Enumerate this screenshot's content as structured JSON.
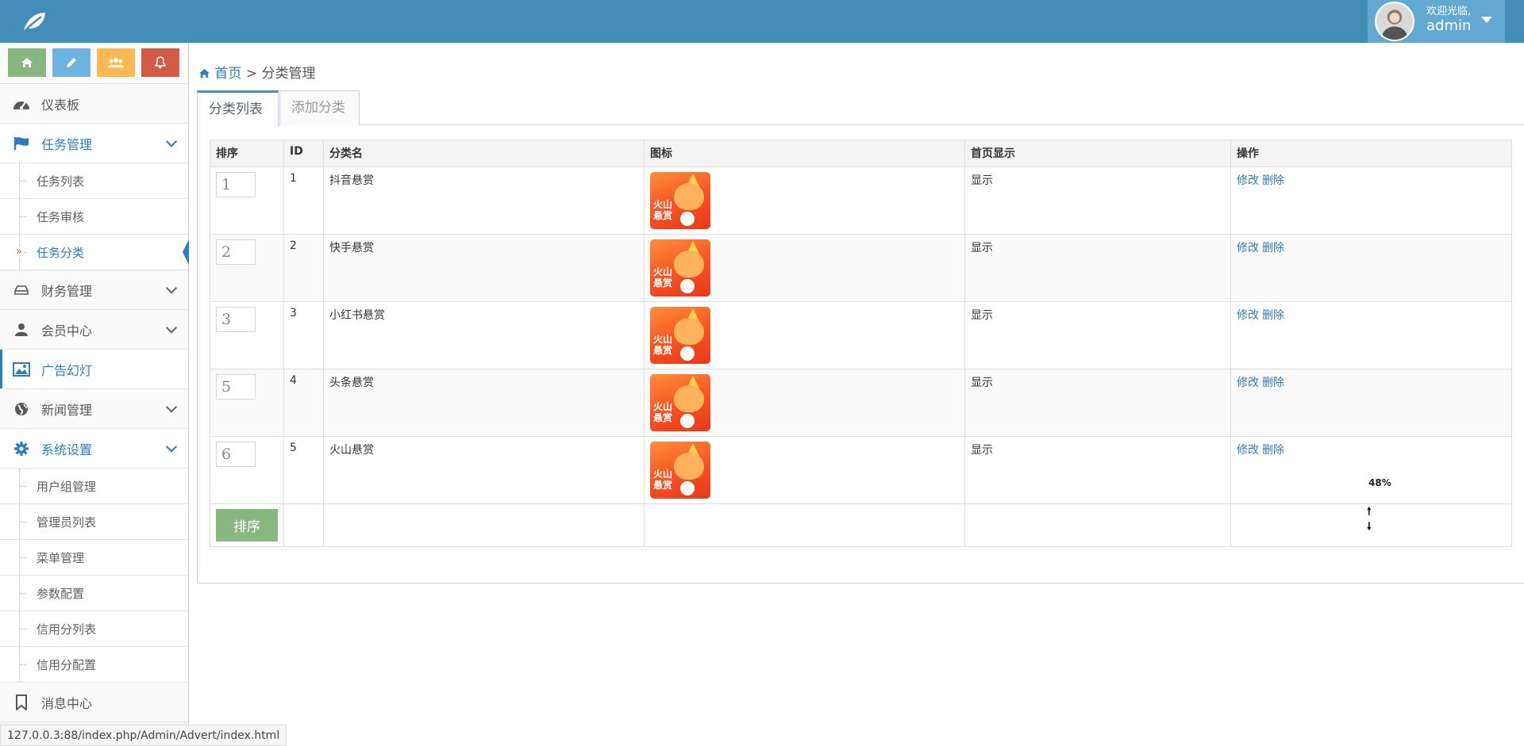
{
  "header": {
    "logo_icon": "leaf-icon",
    "welcome": "欢迎光临,",
    "username": "admin"
  },
  "shortcuts": [
    {
      "icon": "home-icon",
      "color": "#87b87f"
    },
    {
      "icon": "pencil-icon",
      "color": "#6fb3e0"
    },
    {
      "icon": "users-icon",
      "color": "#ffb752"
    },
    {
      "icon": "bell-icon",
      "color": "#d15b47"
    }
  ],
  "sidebar": {
    "dashboard": "仪表板",
    "task_mgmt": "任务管理",
    "task_list": "任务列表",
    "task_review": "任务审核",
    "task_category": "任务分类",
    "finance": "财务管理",
    "members": "会员中心",
    "ads": "广告幻灯",
    "news": "新闻管理",
    "system": "系统设置",
    "user_groups": "用户组管理",
    "admin_list": "管理员列表",
    "menu_mgmt": "菜单管理",
    "params": "参数配置",
    "credit_list": "信用分列表",
    "credit_config": "信用分配置",
    "messages": "消息中心"
  },
  "status_url": "127.0.0.3:88/index.php/Admin/Advert/index.html",
  "breadcrumb": {
    "home": "首页",
    "sep": ">",
    "current": "分类管理"
  },
  "tabs": {
    "list": "分类列表",
    "add": "添加分类"
  },
  "table": {
    "headers": {
      "sort": "排序",
      "id": "ID",
      "name": "分类名",
      "icon": "图标",
      "home_show": "首页显示",
      "ops": "操作"
    },
    "rows": [
      {
        "sort": "1",
        "id": "1",
        "name": "抖音悬赏",
        "show": "显示"
      },
      {
        "sort": "2",
        "id": "2",
        "name": "快手悬赏",
        "show": "显示"
      },
      {
        "sort": "3",
        "id": "3",
        "name": "小红书悬赏",
        "show": "显示"
      },
      {
        "sort": "5",
        "id": "4",
        "name": "头条悬赏",
        "show": "显示"
      },
      {
        "sort": "6",
        "id": "5",
        "name": "火山悬赏",
        "show": "显示"
      }
    ],
    "icon_text_1": "火山",
    "icon_text_2": "悬赏",
    "edit": "修改",
    "delete": "删除",
    "sort_button": "排序"
  },
  "overlay": {
    "percent": "48%",
    "up": "🠕",
    "down": "🠗"
  }
}
